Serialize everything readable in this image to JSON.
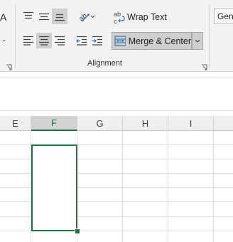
{
  "ribbon": {
    "left_partial_label": "A",
    "wrap_text_label": "Wrap Text",
    "merge_center_label": "Merge & Center",
    "number_format_value": "Gen",
    "group_label": "Alignment"
  },
  "icons": {
    "font_color": "A-letter-icon",
    "top_align": "align-top-icon",
    "middle_align": "align-middle-icon",
    "bottom_align": "align-bottom-icon",
    "orientation": "text-orientation-icon",
    "left_align": "align-left-icon",
    "center_align": "align-center-icon",
    "right_align": "align-right-icon",
    "decrease_indent": "decrease-indent-icon",
    "increase_indent": "increase-indent-icon",
    "wrap_text": "wrap-text-icon",
    "merge_center": "merge-center-icon",
    "dialog_launcher": "dialog-launcher-icon"
  },
  "sheet": {
    "columns": [
      "E",
      "F",
      "G",
      "H",
      "I"
    ],
    "selected_column": "F"
  },
  "colors": {
    "accent": "#217346",
    "pressed": "#d0d0d0",
    "ribbon_bg": "#f3f3f3"
  }
}
